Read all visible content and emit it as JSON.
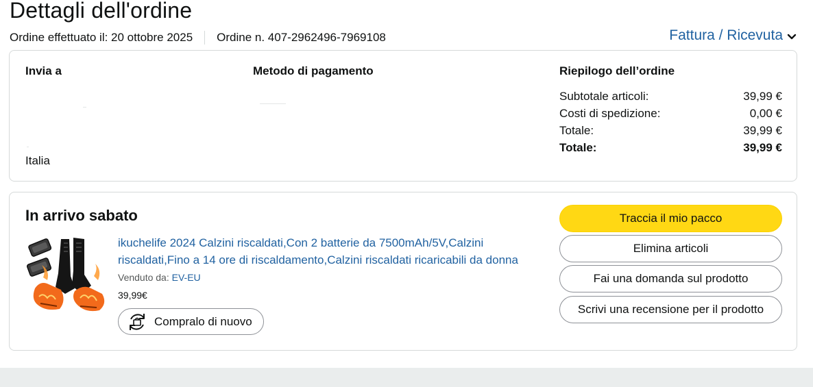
{
  "page": {
    "title": "Dettagli dell'ordine",
    "order_date": "Ordine effettuato il: 20 ottobre 2025",
    "order_number": "Ordine n. 407-2962496-7969108",
    "invoice_link": "Fattura / Ricevuta"
  },
  "order_info": {
    "ship_to_heading": "Invia a",
    "ship_to_country": "Italia",
    "payment_heading": "Metodo di pagamento",
    "summary_heading": "Riepilogo dell’ordine",
    "summary_rows": [
      {
        "label": "Subtotale articoli:",
        "value": "39,99 €"
      },
      {
        "label": "Costi di spedizione:",
        "value": "0,00 €"
      },
      {
        "label": "Totale:",
        "value": "39,99 €"
      },
      {
        "label": "Totale:",
        "value": "39,99 €"
      }
    ]
  },
  "shipment": {
    "status": "In arrivo sabato",
    "product_title": "ikuchelife 2024 Calzini riscaldati,Con 2 batterie da 7500mAh/5V,Calzini riscaldati,Fino a 14 ore di riscaldamento,Calzini riscaldati ricaricabili da donna",
    "sold_by_label": "Venduto da:",
    "seller": "EV-EU",
    "price": "39,99€",
    "buy_again": "Compralo di nuovo",
    "actions": {
      "track": "Traccia il mio pacco",
      "remove": "Elimina articoli",
      "ask": "Fai una domanda sul prodotto",
      "review": "Scrivi una recensione per il prodotto"
    }
  },
  "colors": {
    "link": "#2162a1",
    "primary_button": "#ffd814",
    "border": "#d5d9d9",
    "footer": "#eaeded"
  }
}
